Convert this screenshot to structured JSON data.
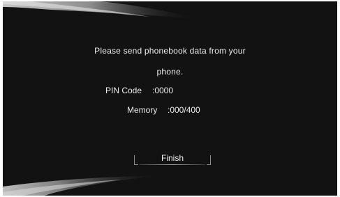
{
  "dialog": {
    "message_line1": "Please send phonebook data from your",
    "message_line2": "phone.",
    "pin_label": "PIN Code",
    "pin_value": ":0000",
    "memory_label": "Memory",
    "memory_value": ":000/400",
    "finish_label": "Finish"
  }
}
